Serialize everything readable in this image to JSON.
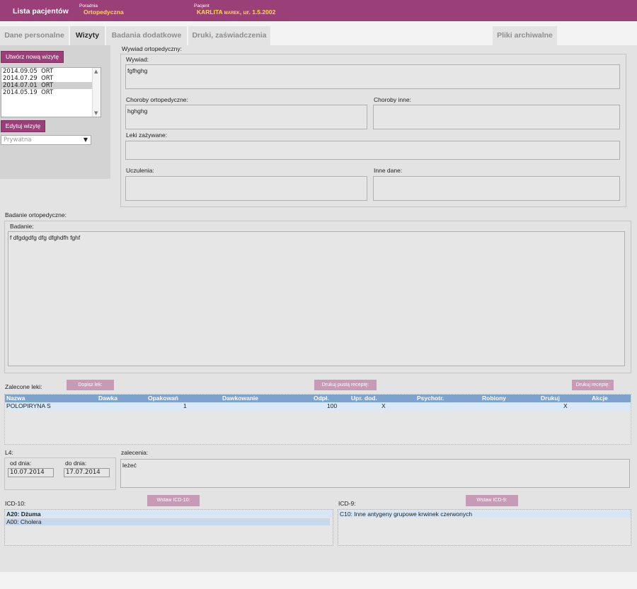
{
  "header": {
    "patient_list": "Lista pacjentów",
    "clinic_label": "Poradnia",
    "clinic_value": "Ortopedyczna",
    "patient_label": "Pacjent",
    "patient_surname": "KARLITA",
    "patient_firstname": "MAREK",
    "patient_born": ", ur. 1.5.2002"
  },
  "tabs": {
    "personal": "Dane personalne",
    "visits": "Wizyty",
    "extra_tests": "Badania dodatkowe",
    "prints": "Druki, zaświadczenia",
    "archive": "Pliki archiwalne"
  },
  "left": {
    "create_visit": "Utwórz nową wizytę",
    "visits": [
      {
        "date": "2014.09.05",
        "type": "ORT"
      },
      {
        "date": "2014.07.29",
        "type": "ORT"
      },
      {
        "date": "2014.07.01",
        "type": "ORT"
      },
      {
        "date": "2014.05.19",
        "type": "ORT"
      }
    ],
    "edit_visit": "Edytuj wizytę",
    "payer_select": "Prywatna"
  },
  "interview": {
    "section_title": "Wywiad ortopedyczny:",
    "wywiad_label": "Wywiad:",
    "wywiad_value": "fgfhghg",
    "ortho_label": "Choroby ortopedyczne:",
    "ortho_value": "hghghg",
    "other_diseases_label": "Choroby inne:",
    "meds_label": "Leki zażywane:",
    "allergies_label": "Uczulenia:",
    "other_data_label": "Inne dane:"
  },
  "exam": {
    "section_title": "Badanie ortopedyczne:",
    "exam_label": "Badanie:",
    "exam_value": "f dfgdgdfg dfg dfghdfh fghf"
  },
  "meds": {
    "label": "Zalecone leki:",
    "add_button": "Dopisz lek:",
    "print_empty_button": "Drukuj pustą receptę:",
    "print_button": "Drukuj receptę:",
    "columns": [
      "Nazwa",
      "Dawka",
      "Opakowań",
      "Dawkowanie",
      "Odpł.",
      "Upr. dod.",
      "Psychotr.",
      "Robiony",
      "Drukuj",
      "Akcje"
    ],
    "rows": [
      {
        "name": "POLOPIRYNA S",
        "dose": "",
        "packs": "1",
        "dosage": "",
        "payment": "100",
        "extra": "X",
        "psych": "",
        "made": "",
        "print": "X",
        "actions": ""
      }
    ]
  },
  "l4": {
    "label": "L4:",
    "from_label": "od dnia:",
    "from_value": "10.07.2014",
    "to_label": "do dnia:",
    "to_value": "17.07.2014"
  },
  "recommendations": {
    "label": "zalecenia:",
    "value": "leżeć"
  },
  "icd10": {
    "label": "ICD-10:",
    "insert_button": "Wstaw ICD-10:",
    "items": [
      "A20: Dżuma",
      "A00: Cholera"
    ]
  },
  "icd9": {
    "label": "ICD-9:",
    "insert_button": "Wstaw ICD-9:",
    "items": [
      "C10: Inne antygeny grupowe krwinek czerwonych"
    ]
  },
  "colors": {
    "brand": "#9b3f79",
    "accent_yellow": "#ffd84a",
    "table_header": "#7da2cc",
    "selection": "#dbe9f7"
  }
}
